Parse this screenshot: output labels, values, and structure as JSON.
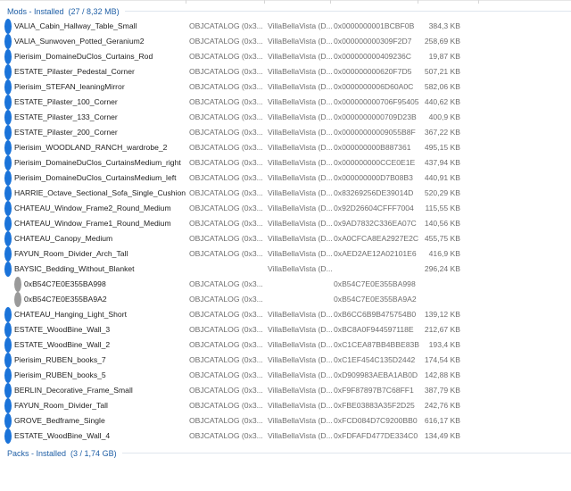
{
  "groups": {
    "mods": {
      "title": "Mods - Installed",
      "count": "(27 / 8,32 MB)"
    },
    "packs": {
      "title": "Packs - Installed",
      "count": "(3 / 1,74 GB)"
    }
  },
  "colors": {
    "accent": "#1f5fa6",
    "dot_blue": "#1a73d9",
    "dot_gray": "#9a9a9a"
  },
  "rows": [
    {
      "name": "VALIA_Cabin_Hallway_Table_Small",
      "catalog": "OBJCATALOG (0x3...",
      "pack": "VillaBellaVista (D...",
      "instance": "0x0000000001BCBF0B",
      "size": "384,3 KB",
      "dot": "blue"
    },
    {
      "name": "VALIA_Sunwoven_Potted_Geranium2",
      "catalog": "OBJCATALOG (0x3...",
      "pack": "VillaBellaVista (D...",
      "instance": "0x000000000309F2D7",
      "size": "258,69 KB",
      "dot": "blue"
    },
    {
      "name": "Pierisim_DomaineDuClos_Curtains_Rod",
      "catalog": "OBJCATALOG (0x3...",
      "pack": "VillaBellaVista (D...",
      "instance": "0x000000000409236C",
      "size": "19,87 KB",
      "dot": "blue"
    },
    {
      "name": "ESTATE_Pilaster_Pedestal_Corner",
      "catalog": "OBJCATALOG (0x3...",
      "pack": "VillaBellaVista (D...",
      "instance": "0x000000000620F7D5",
      "size": "507,21 KB",
      "dot": "blue"
    },
    {
      "name": "Pierisim_STEFAN_leaningMirror",
      "catalog": "OBJCATALOG (0x3...",
      "pack": "VillaBellaVista (D...",
      "instance": "0x0000000006D60A0C",
      "size": "582,06 KB",
      "dot": "blue"
    },
    {
      "name": "ESTATE_Pilaster_100_Corner",
      "catalog": "OBJCATALOG (0x3...",
      "pack": "VillaBellaVista (D...",
      "instance": "0x000000000706F95405",
      "size": "440,62 KB",
      "dot": "blue"
    },
    {
      "name": "ESTATE_Pilaster_133_Corner",
      "catalog": "OBJCATALOG (0x3...",
      "pack": "VillaBellaVista (D...",
      "instance": "0x0000000000709D23B",
      "size": "400,9 KB",
      "dot": "blue"
    },
    {
      "name": "ESTATE_Pilaster_200_Corner",
      "catalog": "OBJCATALOG (0x3...",
      "pack": "VillaBellaVista (D...",
      "instance": "0x00000000009055B8F",
      "size": "367,22 KB",
      "dot": "blue"
    },
    {
      "name": "Pierisim_WOODLAND_RANCH_wardrobe_2",
      "catalog": "OBJCATALOG (0x3...",
      "pack": "VillaBellaVista (D...",
      "instance": "0x000000000B887361",
      "size": "495,15 KB",
      "dot": "blue"
    },
    {
      "name": "Pierisim_DomaineDuClos_CurtainsMedium_right",
      "catalog": "OBJCATALOG (0x3...",
      "pack": "VillaBellaVista (D...",
      "instance": "0x000000000CCE0E1E",
      "size": "437,94 KB",
      "dot": "blue"
    },
    {
      "name": "Pierisim_DomaineDuClos_CurtainsMedium_left",
      "catalog": "OBJCATALOG (0x3...",
      "pack": "VillaBellaVista (D...",
      "instance": "0x000000000D7B08B3",
      "size": "440,91 KB",
      "dot": "blue"
    },
    {
      "name": "HARRIE_Octave_Sectional_Sofa_Single_Cushion",
      "catalog": "OBJCATALOG (0x3...",
      "pack": "VillaBellaVista (D...",
      "instance": "0x83269256DE39014D",
      "size": "520,29 KB",
      "dot": "blue"
    },
    {
      "name": "CHATEAU_Window_Frame2_Round_Medium",
      "catalog": "OBJCATALOG (0x3...",
      "pack": "VillaBellaVista (D...",
      "instance": "0x92D26604CFFF7004",
      "size": "115,55 KB",
      "dot": "blue"
    },
    {
      "name": "CHATEAU_Window_Frame1_Round_Medium",
      "catalog": "OBJCATALOG (0x3...",
      "pack": "VillaBellaVista (D...",
      "instance": "0x9AD7832C336EA07C",
      "size": "140,56 KB",
      "dot": "blue"
    },
    {
      "name": "CHATEAU_Canopy_Medium",
      "catalog": "OBJCATALOG (0x3...",
      "pack": "VillaBellaVista (D...",
      "instance": "0xA0CFCA8EA2927E2C",
      "size": "455,75 KB",
      "dot": "blue"
    },
    {
      "name": "FAYUN_Room_Divider_Arch_Tall",
      "catalog": "OBJCATALOG (0x3...",
      "pack": "VillaBellaVista (D...",
      "instance": "0xAED2AE12A02101E6",
      "size": "416,9 KB",
      "dot": "blue"
    },
    {
      "name": "BAYSIC_Bedding_Without_Blanket",
      "catalog": "",
      "pack": "VillaBellaVista (D...",
      "instance": "",
      "size": "296,24 KB",
      "dot": "blue"
    },
    {
      "name": "0xB54C7E0E355BA998",
      "catalog": "OBJCATALOG (0x3...",
      "pack": "",
      "instance": "0xB54C7E0E355BA998",
      "size": "",
      "dot": "gray",
      "child": true
    },
    {
      "name": "0xB54C7E0E355BA9A2",
      "catalog": "OBJCATALOG (0x3...",
      "pack": "",
      "instance": "0xB54C7E0E355BA9A2",
      "size": "",
      "dot": "gray",
      "child": true
    },
    {
      "name": "CHATEAU_Hanging_Light_Short",
      "catalog": "OBJCATALOG (0x3...",
      "pack": "VillaBellaVista (D...",
      "instance": "0xB6CC6B9B475754B0",
      "size": "139,12 KB",
      "dot": "blue"
    },
    {
      "name": "ESTATE_WoodBine_Wall_3",
      "catalog": "OBJCATALOG (0x3...",
      "pack": "VillaBellaVista (D...",
      "instance": "0xBC8A0F944597118E",
      "size": "212,67 KB",
      "dot": "blue"
    },
    {
      "name": "ESTATE_WoodBine_Wall_2",
      "catalog": "OBJCATALOG (0x3...",
      "pack": "VillaBellaVista (D...",
      "instance": "0xC1CEA87BB4BBE83B",
      "size": "193,4 KB",
      "dot": "blue"
    },
    {
      "name": "Pierisim_RUBEN_books_7",
      "catalog": "OBJCATALOG (0x3...",
      "pack": "VillaBellaVista (D...",
      "instance": "0xC1EF454C135D2442",
      "size": "174,54 KB",
      "dot": "blue"
    },
    {
      "name": "Pierisim_RUBEN_books_5",
      "catalog": "OBJCATALOG (0x3...",
      "pack": "VillaBellaVista (D...",
      "instance": "0xD909983AEBA1AB0D",
      "size": "142,88 KB",
      "dot": "blue"
    },
    {
      "name": "BERLIN_Decorative_Frame_Small",
      "catalog": "OBJCATALOG (0x3...",
      "pack": "VillaBellaVista (D...",
      "instance": "0xF9F87897B7C68FF1",
      "size": "387,79 KB",
      "dot": "blue"
    },
    {
      "name": "FAYUN_Room_Divider_Tall",
      "catalog": "OBJCATALOG (0x3...",
      "pack": "VillaBellaVista (D...",
      "instance": "0xFBE03883A35F2D25",
      "size": "242,76 KB",
      "dot": "blue"
    },
    {
      "name": "GROVE_Bedframe_Single",
      "catalog": "OBJCATALOG (0x3...",
      "pack": "VillaBellaVista (D...",
      "instance": "0xFCD084D7C9200BB0",
      "size": "616,17 KB",
      "dot": "blue"
    },
    {
      "name": "ESTATE_WoodBine_Wall_4",
      "catalog": "OBJCATALOG (0x3...",
      "pack": "VillaBellaVista (D...",
      "instance": "0xFDFAFD477DE334C0",
      "size": "134,49 KB",
      "dot": "blue"
    }
  ]
}
